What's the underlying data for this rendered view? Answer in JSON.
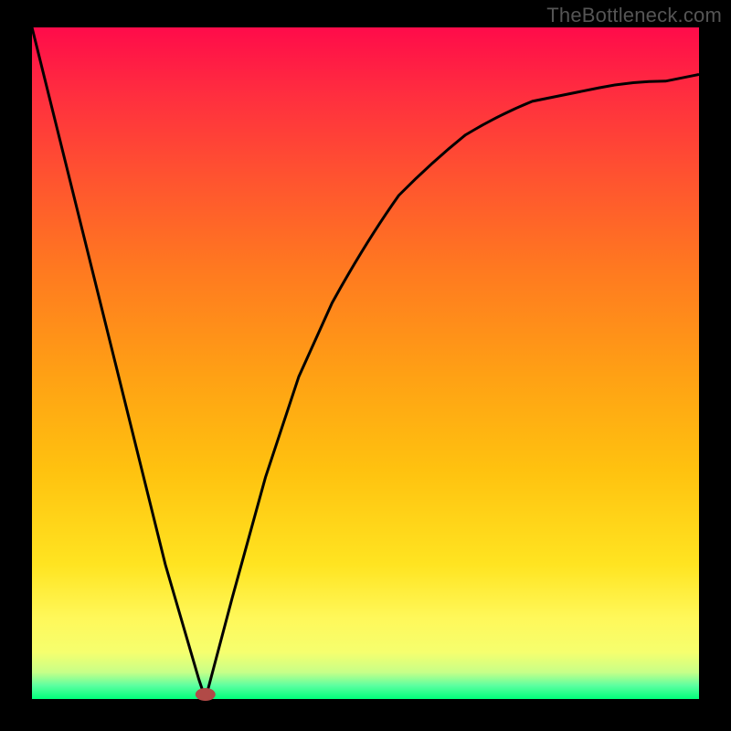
{
  "watermark": "TheBottleneck.com",
  "chart_data": {
    "type": "line",
    "title": "",
    "xlabel": "",
    "ylabel": "",
    "xlim": [
      0,
      100
    ],
    "ylim": [
      0,
      100
    ],
    "grid": false,
    "legend": false,
    "series": [
      {
        "name": "bottleneck-curve",
        "x": [
          0,
          5,
          10,
          15,
          20,
          25,
          26,
          30,
          35,
          40,
          45,
          50,
          55,
          60,
          65,
          70,
          75,
          80,
          85,
          90,
          95,
          100
        ],
        "values": [
          100,
          80,
          60,
          40,
          20,
          3,
          0,
          15,
          33,
          48,
          59,
          68,
          75,
          80,
          84,
          87,
          89,
          90,
          91,
          92,
          92,
          93
        ]
      }
    ],
    "annotations": [
      {
        "name": "curve-minimum",
        "x": 26,
        "y": 0
      }
    ],
    "background_gradient": {
      "top": "#ff0b4a",
      "mid": "#ffd52a",
      "bottom": "#00ff7a"
    }
  }
}
